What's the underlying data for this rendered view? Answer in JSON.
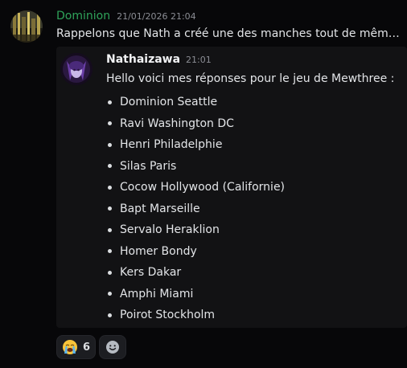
{
  "message": {
    "author": "Dominion",
    "timestamp": "21/01/2026 21:04",
    "text": "Rappelons que Nath a créé une des manches tout de même...",
    "avatar_icon": "city-night-avatar"
  },
  "forwarded": {
    "author": "Nathaizawa",
    "timestamp": "21:01",
    "intro": "Hello voici mes réponses pour le jeu de Mewthree :",
    "avatar_icon": "purple-character-avatar",
    "items": [
      "Dominion Seattle",
      "Ravi Washington DC",
      "Henri Philadelphie",
      "Silas Paris",
      "Cocow Hollywood (Californie)",
      "Bapt Marseille",
      "Servalo Heraklion",
      "Homer Bondy",
      "Kers Dakar",
      "Amphi Miami",
      "Poirot Stockholm"
    ]
  },
  "reactions": [
    {
      "emoji": "loudly-crying-face-icon",
      "count": "6"
    }
  ],
  "add_reaction_icon": "add-reaction-smiley-icon",
  "colors": {
    "background": "#070709",
    "author_green": "#2fa35a",
    "timestamp_gray": "#8b8d94"
  }
}
